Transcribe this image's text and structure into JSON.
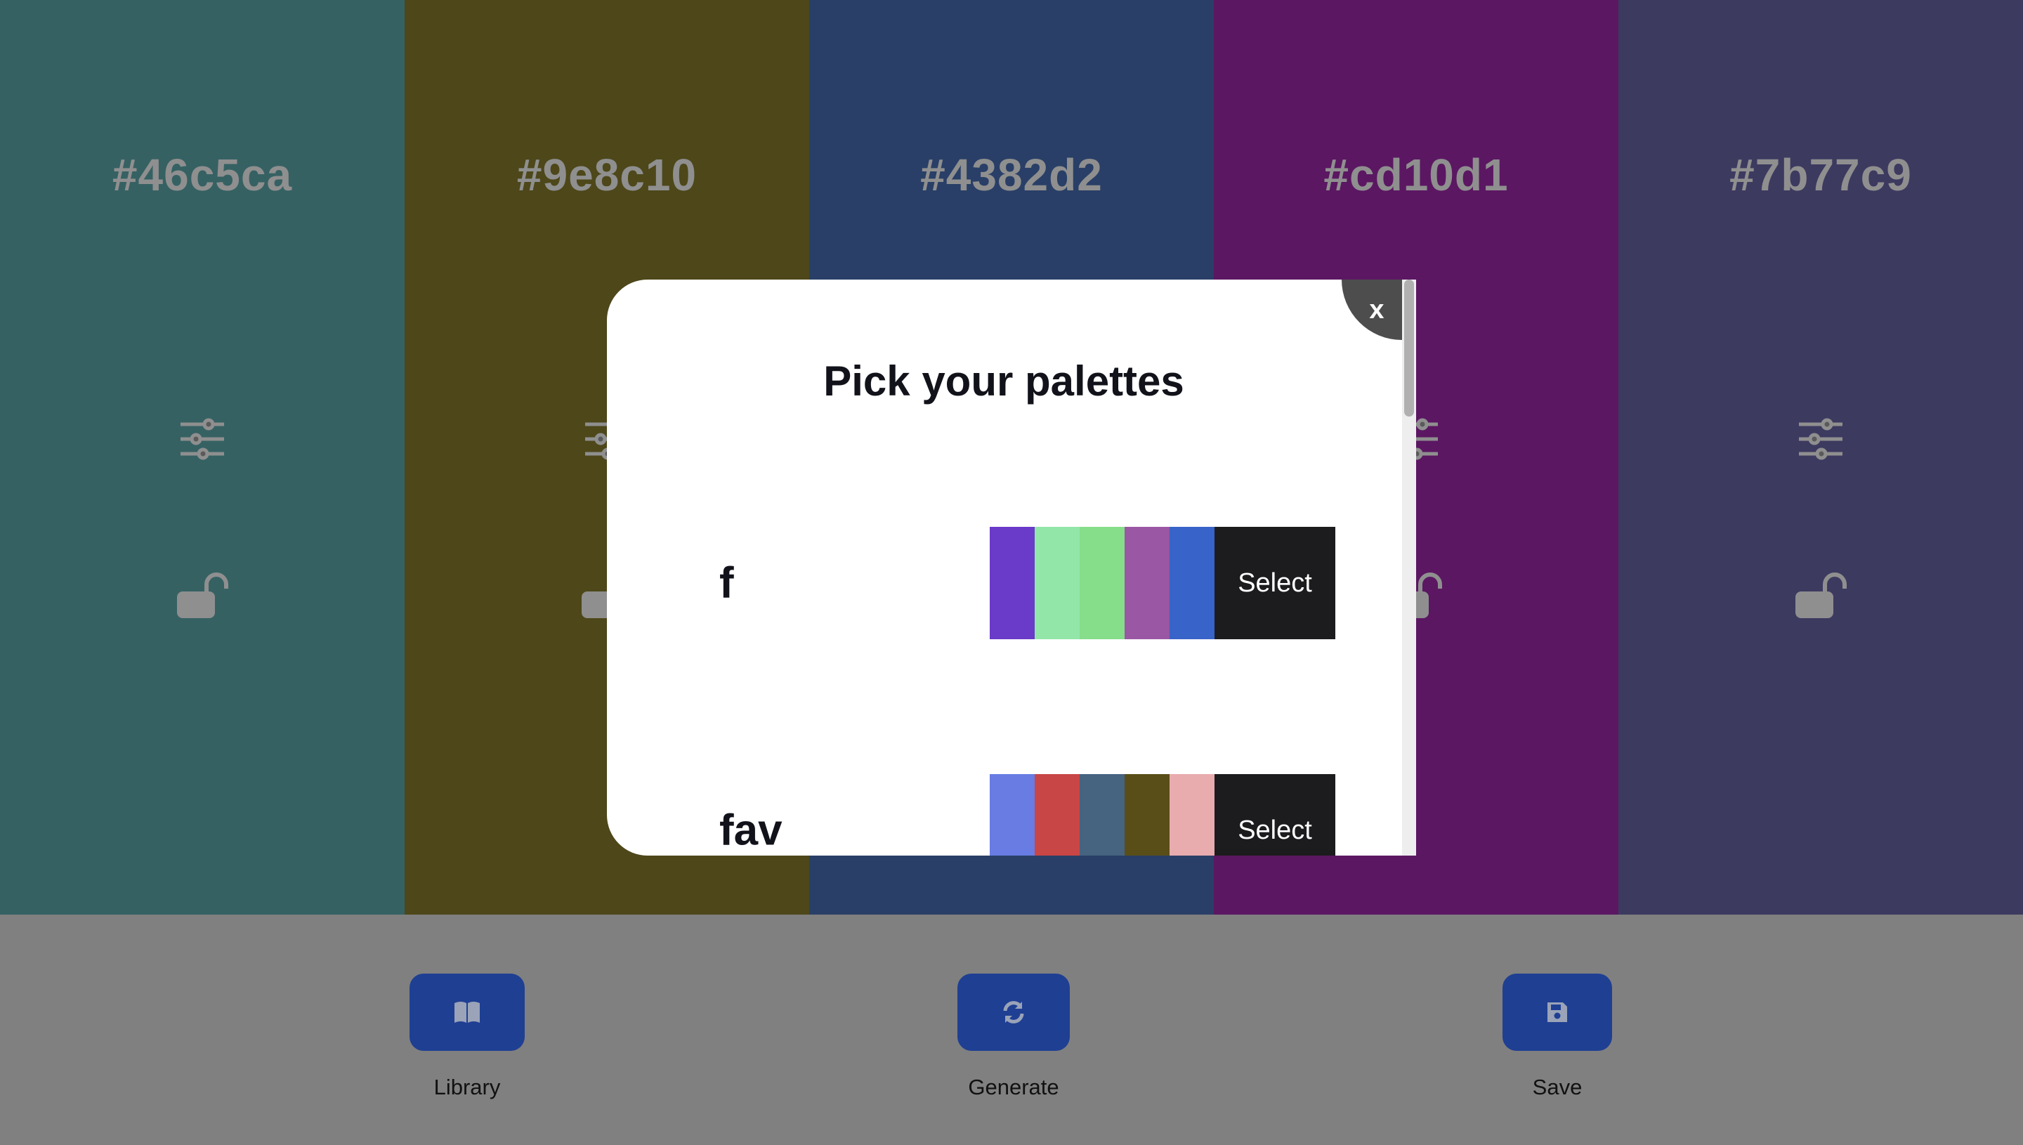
{
  "columns": [
    {
      "hex": "#46c5ca",
      "bg": "#366163"
    },
    {
      "hex": "#9e8c10",
      "bg": "#4d471a"
    },
    {
      "hex": "#4382d2",
      "bg": "#293f67"
    },
    {
      "hex": "#cd10d1",
      "bg": "#5b1762"
    },
    {
      "hex": "#7b77c9",
      "bg": "#3d3a60"
    }
  ],
  "icons": {
    "adjust": "sliders-icon",
    "lock": "unlock-icon"
  },
  "modal": {
    "title": "Pick your palettes",
    "close_label": "x",
    "palettes": [
      {
        "name": "f",
        "colors": [
          "#6a3ac8",
          "#92e6a8",
          "#86dd8a",
          "#9a57a3",
          "#3863c8"
        ],
        "select_label": "Select"
      },
      {
        "name": "fav",
        "colors": [
          "#687ce3",
          "#c84646",
          "#466380",
          "#5a4e18",
          "#e8abae"
        ],
        "select_label": "Select"
      }
    ]
  },
  "controls": {
    "library": {
      "label": "Library",
      "icon": "book-icon"
    },
    "generate": {
      "label": "Generate",
      "icon": "refresh-icon"
    },
    "save": {
      "label": "Save",
      "icon": "save-icon"
    }
  },
  "colors": {
    "button": "#1f3f93",
    "control_bar": "#808080",
    "select": "#1c1c1e"
  }
}
